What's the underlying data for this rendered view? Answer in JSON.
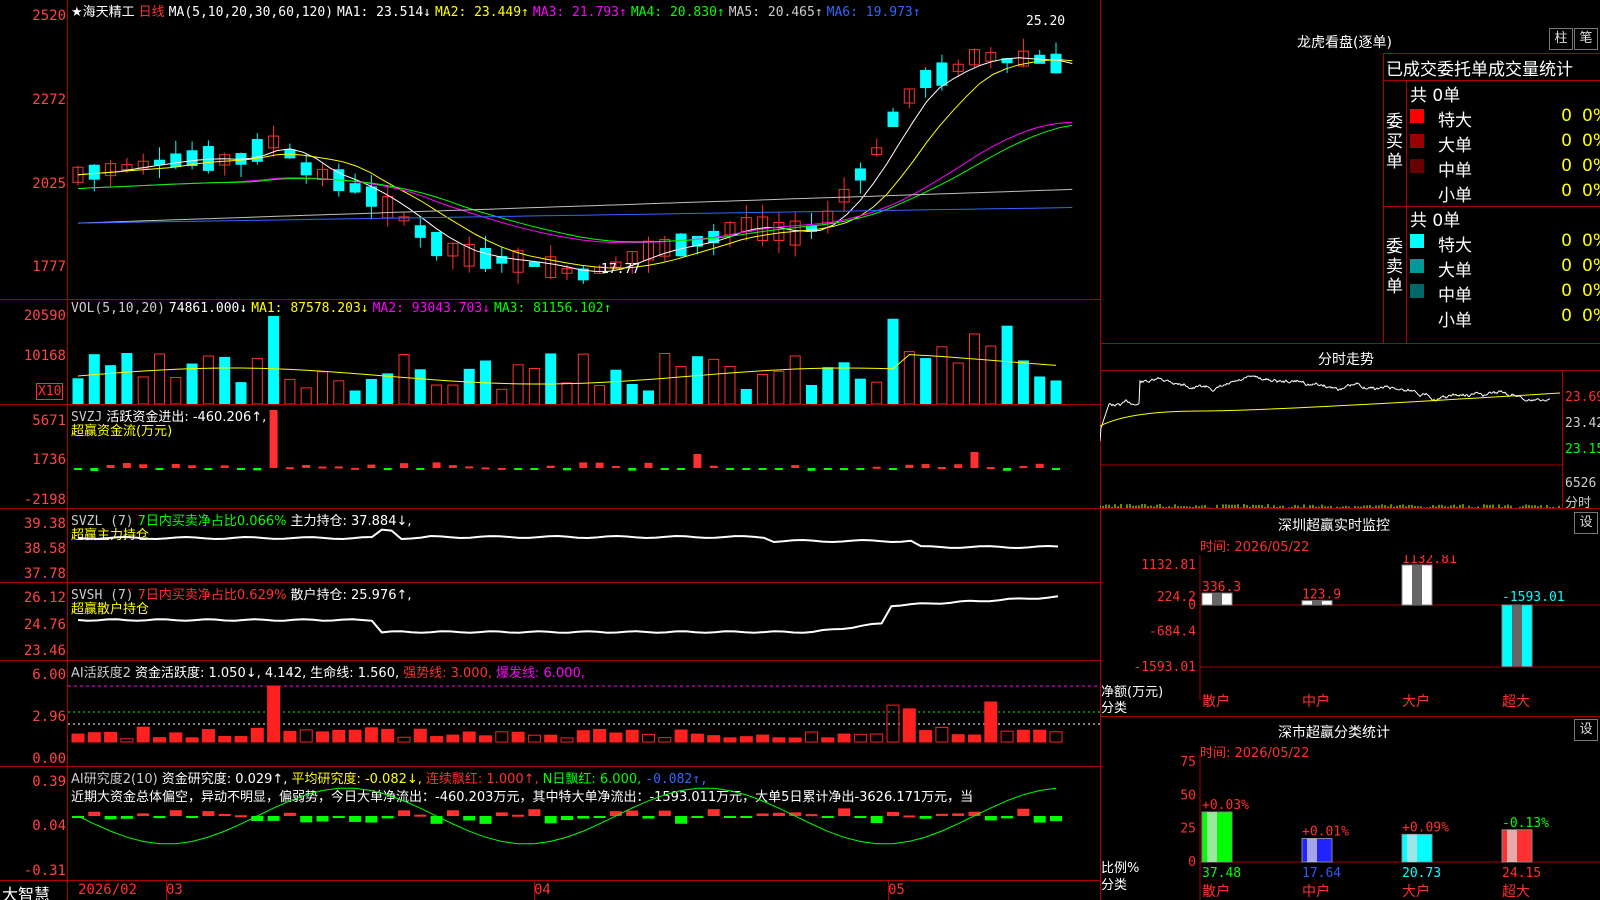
{
  "stock": {
    "name": "★海天精工",
    "period": "日线",
    "ma_label": "MA(5,10,20,30,60,120)",
    "ma": [
      {
        "t": "MA1: 23.514↓",
        "c": "#ffffff"
      },
      {
        "t": "MA2: 23.449↑",
        "c": "#ffff00"
      },
      {
        "t": "MA3: 21.793↑",
        "c": "#ff00ff"
      },
      {
        "t": "MA4: 20.830↑",
        "c": "#00ff00"
      },
      {
        "t": "MA5: 20.465↑",
        "c": "#c0c0c0"
      },
      {
        "t": "MA6: 19.973↑",
        "c": "#3366ff"
      }
    ],
    "high_label": "25.20",
    "low_label": "17.77",
    "price_axis": [
      "2520",
      "2272",
      "2025",
      "1777"
    ],
    "unit": "X10"
  },
  "vol": {
    "label": "VOL(5,10,20)",
    "value": "74861.000↓",
    "ma1": "MA1: 87578.203↓",
    "ma2": "MA2: 93043.703↓",
    "ma3": "MA3: 81156.102↑",
    "axis": [
      "20590",
      "10168"
    ]
  },
  "svzj": {
    "label": "SVZJ",
    "desc": "活跃资金进出: -460.206↑,",
    "title": "超赢资金流(万元)",
    "axis": [
      "5671",
      "1736",
      "-2198"
    ]
  },
  "svzl": {
    "label": "SVZL (7)",
    "desc1": "7日内买卖净占比0.066%",
    "desc2": "主力持仓: 37.884↓,",
    "title": "超赢主力持仓",
    "axis": [
      "39.38",
      "38.58",
      "37.78"
    ]
  },
  "svsh": {
    "label": "SVSH (7)",
    "desc1": "7日内买卖净占比0.629%",
    "desc2": "散户持仓: 25.976↑,",
    "title": "超赢散户持仓",
    "axis": [
      "26.12",
      "24.76",
      "23.46"
    ]
  },
  "ai1": {
    "label": "AI活跃度2",
    "t1": "资金活跃度: 1.050↓, 4.142,",
    "t2": "生命线: 1.560,",
    "t3": "强势线: 3.000,",
    "t4": "爆发线: 6.000,",
    "axis": [
      "6.00",
      "2.96",
      "0.00"
    ]
  },
  "ai2": {
    "label": "AI研究度2(10)",
    "t1": "资金研究度: 0.029↑,",
    "t2": "平均研究度: -0.082↓,",
    "t3": "连续飘红: 1.000↑,",
    "t4": "N日飘红: 6.000,",
    "t5": "-0.082↑,",
    "text": "近期大资金总体偏空，异动不明显，偏弱势，今日大单净流出：-460.203万元，其中特大单净流出：-1593.011万元，大单5日累计净出-3626.171万元，当",
    "axis": [
      "0.39",
      "0.04",
      "-0.31"
    ]
  },
  "time_axis": {
    "brand": "大智慧",
    "labels": [
      "2026/02",
      "03",
      "04",
      "05"
    ]
  },
  "right": {
    "lhb_title": "龙虎看盘(逐单)",
    "btn_col": "柱",
    "btn_pen": "笔",
    "tab_label": "已成交委托单成交量统计",
    "buy": {
      "side": "委买单",
      "count": "共 0单",
      "rows": [
        {
          "n": "特大",
          "v": "0",
          "p": "0%",
          "c": "#ff0000"
        },
        {
          "n": "大单",
          "v": "0",
          "p": "0%",
          "c": "#990000"
        },
        {
          "n": "中单",
          "v": "0",
          "p": "0%",
          "c": "#660000"
        },
        {
          "n": "小单",
          "v": "0",
          "p": "0%",
          "c": ""
        }
      ]
    },
    "sell": {
      "side": "委卖单",
      "count": "共 0单",
      "rows": [
        {
          "n": "特大",
          "v": "0",
          "p": "0%",
          "c": "#00ffff"
        },
        {
          "n": "大单",
          "v": "0",
          "p": "0%",
          "c": "#009999"
        },
        {
          "n": "中单",
          "v": "0",
          "p": "0%",
          "c": "#006666"
        },
        {
          "n": "小单",
          "v": "0",
          "p": "0%",
          "c": ""
        }
      ]
    },
    "fs_title": "分时走势",
    "fs_axis": [
      "23.69",
      "23.42",
      "23.15"
    ],
    "fs_vol": "6526",
    "fs_unit": "分时",
    "mon": {
      "title": "深圳超赢实时监控",
      "time": "时间: 2026/05/22",
      "set": "设",
      "axis": [
        "1132.81",
        "224.2",
        "0",
        "-684.4",
        "-1593.01"
      ],
      "ylabel": "净额(万元)",
      "xlabel": "分类"
    },
    "cls": {
      "title": "深市超赢分类统计",
      "time": "时间: 2026/05/22",
      "set": "设",
      "axis": [
        "75",
        "50",
        "25",
        "0"
      ],
      "ylabel": "比例%",
      "xlabel": "分类"
    }
  },
  "chart_data": [
    {
      "type": "bar",
      "title": "深圳超赢实时监控",
      "categories": [
        "散户",
        "中户",
        "大户",
        "超大"
      ],
      "values": [
        336.3,
        123.9,
        1132.81,
        -1593.01
      ],
      "ylim": [
        -1593.01,
        1132.81
      ],
      "colors": [
        "#ffffff",
        "#ffffff",
        "#ffffff",
        "#00ffff"
      ]
    },
    {
      "type": "bar",
      "title": "深市超赢分类统计",
      "categories": [
        "散户",
        "中户",
        "大户",
        "超大"
      ],
      "values": [
        37.48,
        17.64,
        20.73,
        24.15
      ],
      "labels": [
        "+0.03%",
        "+0.01%",
        "+0.09%",
        "-0.13%"
      ],
      "label_colors": [
        "#ff3030",
        "#ff3030",
        "#ff3030",
        "#00ff00"
      ],
      "ylim": [
        0,
        75
      ],
      "colors": [
        "#00ff00",
        "#2222ff",
        "#00ffff",
        "#ff3030"
      ]
    }
  ]
}
